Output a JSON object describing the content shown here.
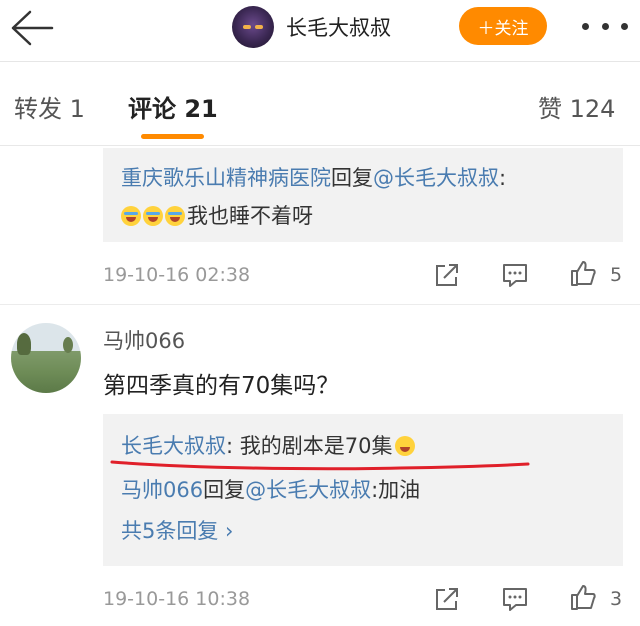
{
  "header": {
    "back_icon": "back-arrow-icon",
    "owner_name": "长毛大叔叔",
    "follow_label": "＋关注",
    "more_icon": "more-dots-icon",
    "accent": "#ff8a00"
  },
  "tabs": {
    "repost": "转发 1",
    "comment": "评论 21",
    "like": "赞 124"
  },
  "thread1": {
    "reply_author": "重庆歌乐山精神病医院",
    "reply_word": "回复",
    "reply_target": "@长毛大叔叔",
    "reply_colon": ":",
    "emoji_icon": "crying-face-icon",
    "reply_text": "我也睡不着呀",
    "time": "19-10-16 02:38",
    "likes": "5"
  },
  "comment2": {
    "author": "马帅066",
    "text": "第四季真的有70集吗？",
    "replies": [
      {
        "author": "长毛大叔叔",
        "sep": ": ",
        "text": "我的剧本是70集",
        "emoji_icon": "smile-face-icon"
      },
      {
        "author": "马帅066",
        "word": "回复",
        "target": "@长毛大叔叔",
        "text": ":加油"
      }
    ],
    "more_replies": "共5条回复 ›",
    "time": "19-10-16 10:38",
    "likes": "3",
    "annotation_color": "#e0202a"
  },
  "link_color": "#4a7cb0"
}
